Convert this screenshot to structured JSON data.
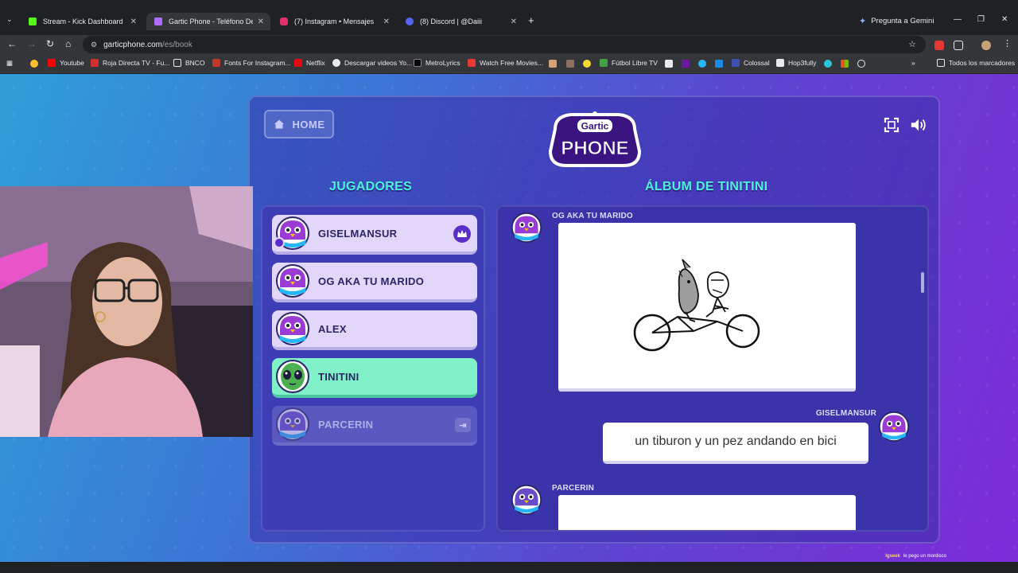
{
  "browser": {
    "tabs": [
      {
        "title": "Stream - Kick Dashboard",
        "favicon_color": "#53fc18",
        "active": false
      },
      {
        "title": "Gartic Phone - Teléfono Descon",
        "favicon_color": "#b06cff",
        "active": true
      },
      {
        "title": "(7) Instagram • Mensajes",
        "favicon_color": "#e1306c",
        "active": false
      },
      {
        "title": "(8) Discord | @Daiii",
        "favicon_color": "#5865f2",
        "active": false
      }
    ],
    "gemini_label": "Pregunta a Gemini",
    "url_host": "garticphone.com",
    "url_path": "/es/book",
    "bookmarks": [
      {
        "label": "Youtube",
        "color": "#ff0000"
      },
      {
        "label": "Roja Directa TV - Fu...",
        "color": "#d32f2f"
      },
      {
        "label": "BNCO",
        "color": "#e8eaed"
      },
      {
        "label": "Fonts For Instagram...",
        "color": "#e8eaed"
      },
      {
        "label": "Netflix",
        "color": "#e50914"
      },
      {
        "label": "Descargar videos Yo...",
        "color": "#e8eaed"
      },
      {
        "label": "MetroLyrics",
        "color": "#e8eaed"
      },
      {
        "label": "Watch Free Movies...",
        "color": "#e53935"
      },
      {
        "label": "Fútbol Libre TV",
        "color": "#43a047"
      },
      {
        "label": "Colossal",
        "color": "#3f51b5"
      },
      {
        "label": "Hop3fully",
        "color": "#e8eaed"
      }
    ],
    "all_bookmarks_label": "Todos los marcadores"
  },
  "game": {
    "home_label": "HOME",
    "logo_top": "Gartic",
    "logo_bottom": "PHONE",
    "players_title": "JUGADORES",
    "album_title": "ÁLBUM DE TINITINI",
    "players": [
      {
        "name": "GISELMANSUR",
        "state": "host",
        "avatar_color": "#9b3bd6"
      },
      {
        "name": "OG AKA TU MARIDO",
        "state": "normal",
        "avatar_color": "#9b3bd6"
      },
      {
        "name": "ALEX",
        "state": "normal",
        "avatar_color": "#9b3bd6"
      },
      {
        "name": "TINITINI",
        "state": "active",
        "avatar_color": "#4caf50"
      },
      {
        "name": "PARCERIN",
        "state": "offline",
        "avatar_color": "#6a4cc9"
      }
    ],
    "album": [
      {
        "author": "OG AKA TU MARIDO",
        "type": "drawing"
      },
      {
        "author": "GISELMANSUR",
        "type": "text",
        "text": "un tiburon y un pez andando en bici"
      },
      {
        "author": "PARCERIN",
        "type": "drawing"
      }
    ]
  },
  "stream_caption": {
    "user": "lgseek",
    "message": "le pego un mordisco"
  },
  "colors": {
    "accent_teal": "#4ff0d8",
    "active_player": "#7ff0c8",
    "card": "#e2d7fb"
  }
}
